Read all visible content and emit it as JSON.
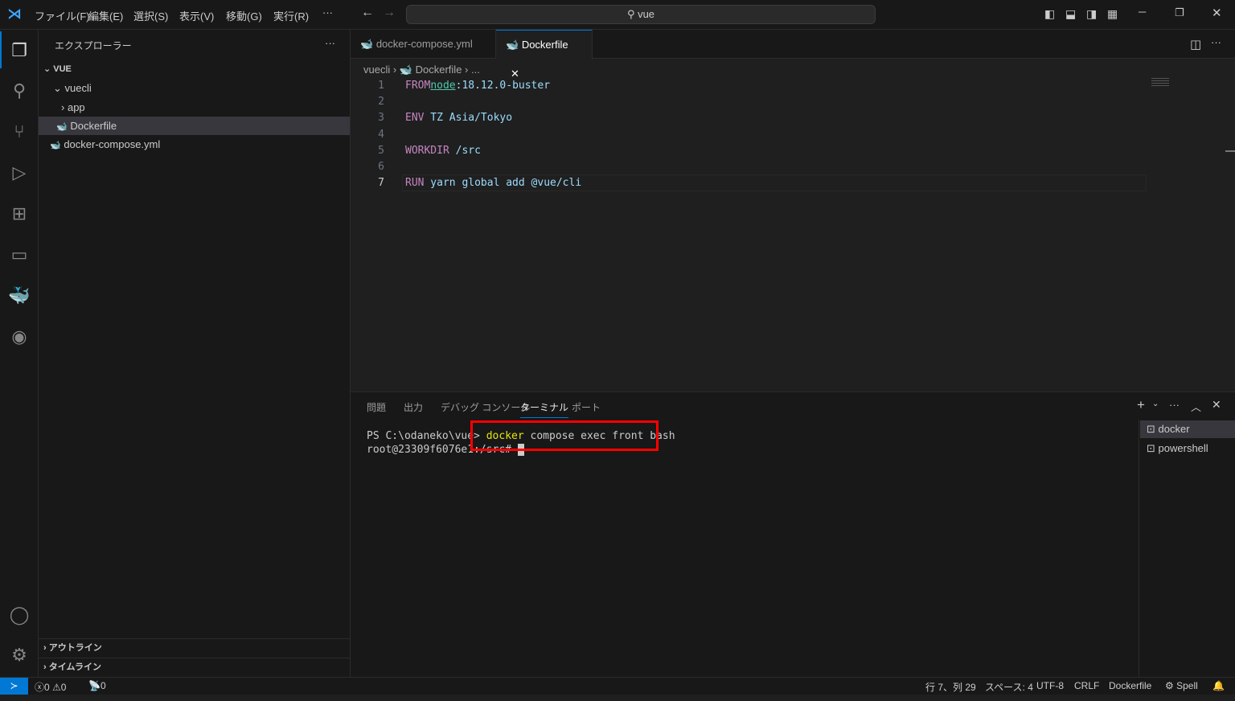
{
  "titlebar": {
    "menus": [
      "ファイル(F)",
      "編集(E)",
      "選択(S)",
      "表示(V)",
      "移動(G)",
      "実行(R)",
      "···"
    ],
    "search": "vue"
  },
  "sidebar": {
    "title": "エクスプローラー",
    "more": "···",
    "root": "VUE",
    "tree": [
      {
        "label": "vuecli"
      },
      {
        "label": "app"
      },
      {
        "label": "Dockerfile"
      },
      {
        "label": "docker-compose.yml"
      }
    ],
    "outline": "アウトライン",
    "timeline": "タイムライン"
  },
  "editor": {
    "tabs": [
      {
        "label": "docker-compose.yml"
      },
      {
        "label": "Dockerfile",
        "active": true
      }
    ],
    "breadcrumb": [
      "vuecli",
      "Dockerfile",
      "..."
    ],
    "lines": [
      {
        "n": "1",
        "kw": "FROM",
        "img": "node",
        "rest": ":18.12.0-buster"
      },
      {
        "n": "2"
      },
      {
        "n": "3",
        "kw": "ENV",
        "rest": " TZ Asia/Tokyo"
      },
      {
        "n": "4"
      },
      {
        "n": "5",
        "kw": "WORKDIR",
        "rest": " /src"
      },
      {
        "n": "6"
      },
      {
        "n": "7",
        "kw": "RUN",
        "rest": " yarn global add @vue/cli"
      }
    ]
  },
  "panel": {
    "tabs": [
      "問題",
      "出力",
      "デバッグ コンソール",
      "ターミナル",
      "ポート"
    ],
    "active_tab": "ターミナル",
    "terminal": {
      "prompt": "PS C:\\odaneko\\vue> ",
      "cmd": "docker",
      "args": " compose exec front bash",
      "line2": "root@23309f6076e1:/src# "
    },
    "instances": [
      "docker",
      "powershell"
    ]
  },
  "status": {
    "errors": "0",
    "warnings": "0",
    "ports": "0",
    "position": "行 7、列 29",
    "spaces": "スペース: 4",
    "encoding": "UTF-8",
    "eol": "CRLF",
    "language": "Dockerfile",
    "spell": "Spell"
  },
  "colors": {
    "accent": "#0078d4",
    "highlight_box": "#ff0000"
  }
}
